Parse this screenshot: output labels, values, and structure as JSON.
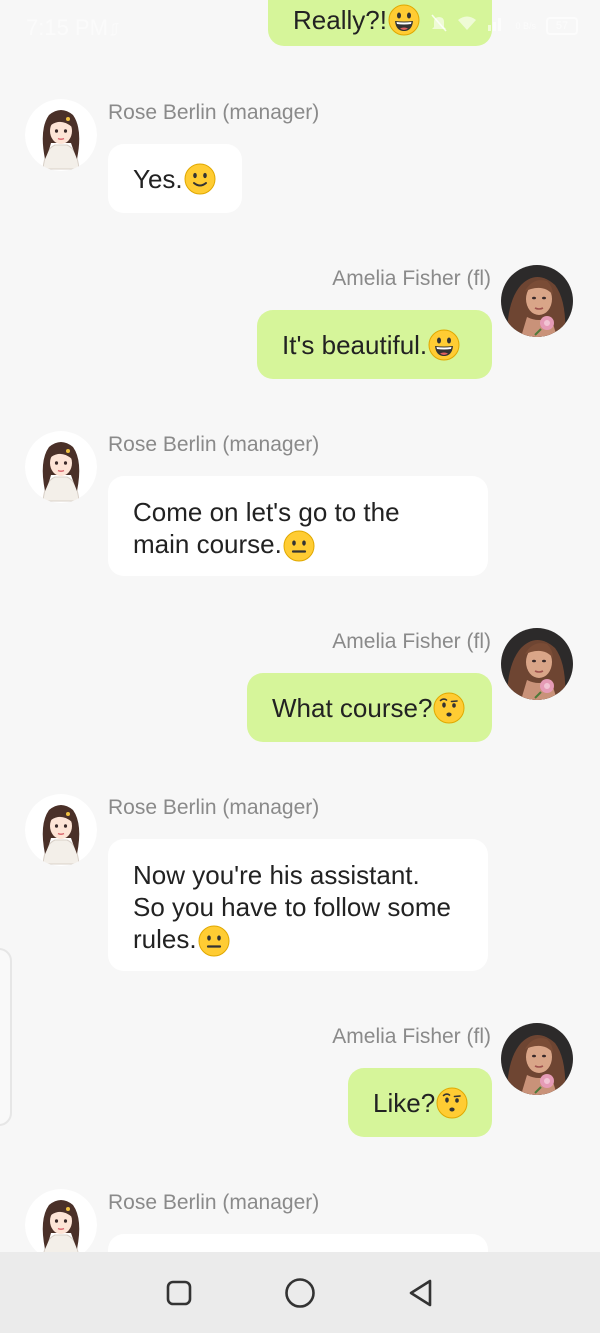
{
  "status_bar": {
    "time": "7:15 PM",
    "network_speed": "0 B/s",
    "battery": "57",
    "icons": [
      "usb-icon",
      "mute-icon",
      "wifi-icon",
      "signal-icon",
      "battery-icon"
    ]
  },
  "colors": {
    "background": "#f7f7f7",
    "outgoing_bubble": "#d6f59a",
    "incoming_bubble": "#ffffff",
    "sender_name": "#8a8a8a",
    "nav_bar": "#ebebeb"
  },
  "messages": [
    {
      "direction": "outgoing",
      "sender": "",
      "text": "Really?!",
      "emoji": "grinning-face-icon"
    },
    {
      "direction": "incoming",
      "sender": "Rose Berlin (manager)",
      "text": "Yes.",
      "emoji": "slightly-smiling-face-icon"
    },
    {
      "direction": "outgoing",
      "sender": "Amelia Fisher (fl)",
      "text": "It's beautiful.",
      "emoji": "grinning-face-icon"
    },
    {
      "direction": "incoming",
      "sender": "Rose Berlin (manager)",
      "lines": [
        "Come on let's go to the",
        "main course."
      ],
      "emoji": "neutral-face-icon"
    },
    {
      "direction": "outgoing",
      "sender": "Amelia Fisher (fl)",
      "text": "What course?",
      "emoji": "face-with-raised-eyebrow-icon"
    },
    {
      "direction": "incoming",
      "sender": "Rose Berlin (manager)",
      "lines": [
        "Now you're his assistant.",
        "So you have to follow some",
        "rules."
      ],
      "emoji": "neutral-face-icon"
    },
    {
      "direction": "outgoing",
      "sender": "Amelia Fisher (fl)",
      "text": "Like?",
      "emoji": "face-with-raised-eyebrow-icon"
    },
    {
      "direction": "incoming",
      "sender": "Rose Berlin (manager)",
      "text": ""
    }
  ],
  "nav_bar": {
    "buttons": [
      "recent-apps-icon",
      "home-icon",
      "back-icon"
    ]
  }
}
